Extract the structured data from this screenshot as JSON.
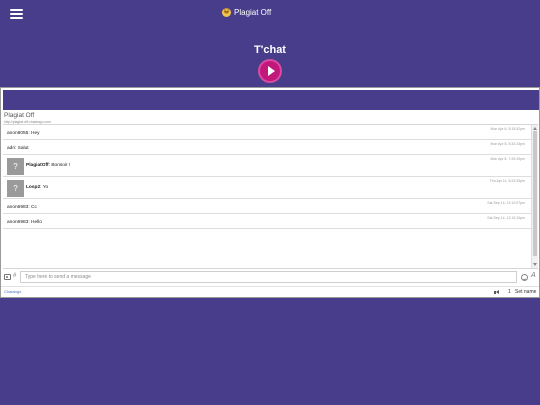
{
  "header": {
    "brand_title": "Plagiat Off",
    "brand_emoji": "😀",
    "menu_icon": "hamburger-menu-icon"
  },
  "page": {
    "title": "T'chat",
    "play_icon": "play-icon"
  },
  "chat": {
    "room_title": "Plagiat Off",
    "room_url": "http://plagiat-off.chatango.com",
    "messages": [
      {
        "user": "anon8055",
        "text": "Hey",
        "time": "Mon Apr 8, 5:15:52pm",
        "avatar": false
      },
      {
        "user": "adri",
        "text": "Salut",
        "time": "Mon Apr 8, 5:32:24pm",
        "avatar": false
      },
      {
        "user": "PlagiatOff",
        "text": "Bonsoir !",
        "time": "Mon Apr 8, 7:20:43pm",
        "avatar": true,
        "avatar_glyph": "?"
      },
      {
        "user": "Losp2",
        "text": "Yo",
        "time": "Thu Apr 11, 5:24:33pm",
        "avatar": true,
        "avatar_glyph": "?"
      },
      {
        "user": "anon6983",
        "text": "Cc",
        "time": "Sat Sep 14, 12:10:07pm",
        "avatar": false
      },
      {
        "user": "anon6983",
        "text": "Hello",
        "time": "Sat Sep 14, 12:10:10pm",
        "avatar": false
      }
    ],
    "input_placeholder": "Type here to send a message",
    "hash_glyph": "#",
    "font_glyph": "A",
    "footer_brand": "Chatango",
    "user_count": "1",
    "set_name_label": "Set name"
  },
  "colors": {
    "background": "#483d8b",
    "play_button": "#c2187c",
    "link": "#4a72b8"
  }
}
